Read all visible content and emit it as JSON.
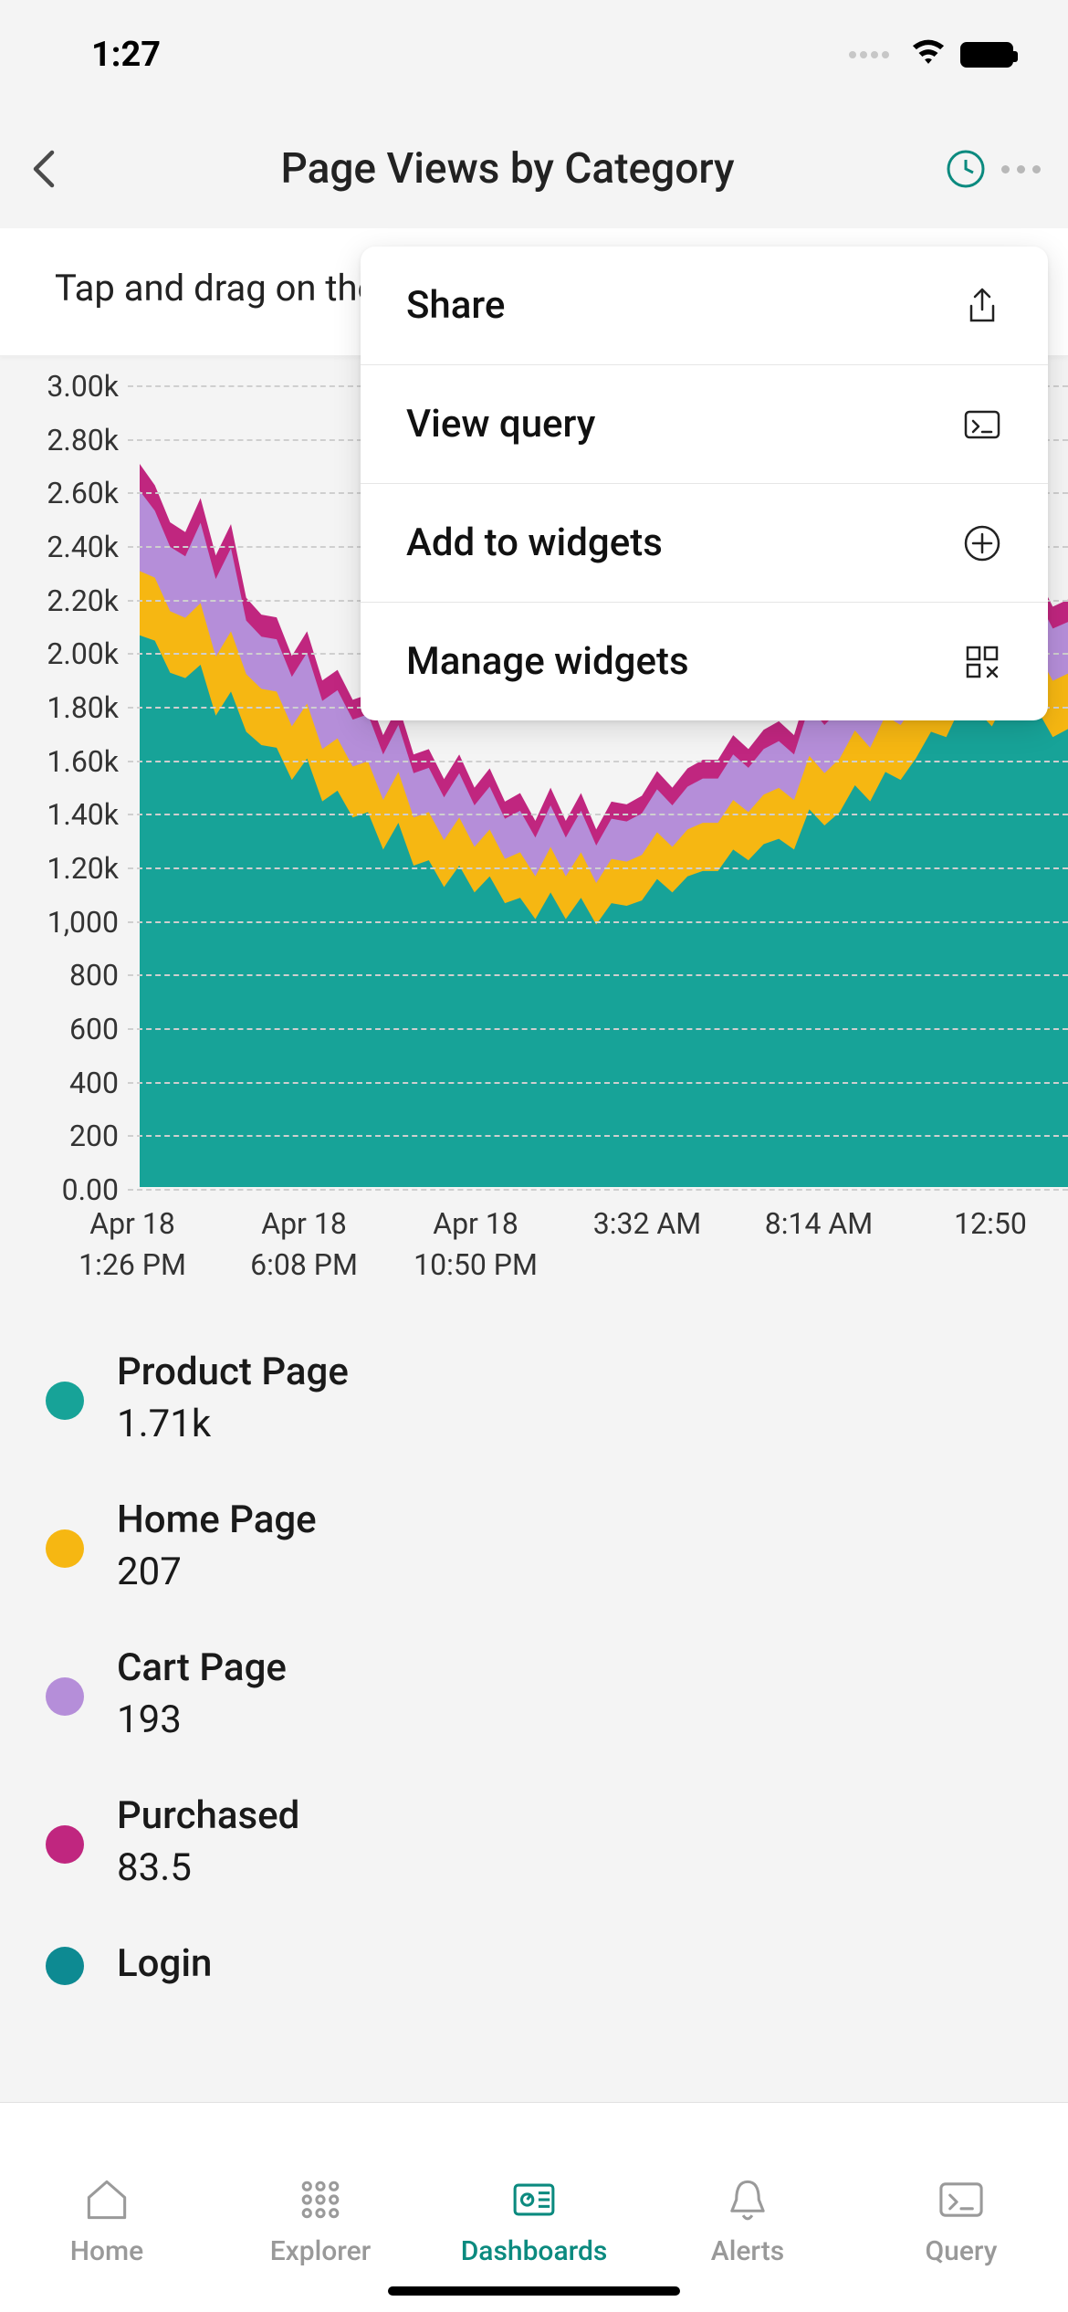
{
  "status": {
    "time": "1:27"
  },
  "header": {
    "title": "Page Views by Category"
  },
  "hint": "Tap and drag on the chart",
  "menu": {
    "items": [
      {
        "label": "Share",
        "icon": "share-icon"
      },
      {
        "label": "View query",
        "icon": "terminal-icon"
      },
      {
        "label": "Add to widgets",
        "icon": "plus-circle-icon"
      },
      {
        "label": "Manage widgets",
        "icon": "widgets-icon"
      }
    ]
  },
  "chart_data": {
    "type": "area",
    "stacking": "stacked",
    "ylabel": "",
    "xlabel": "",
    "ylim": [
      0,
      3000
    ],
    "y_ticks": [
      "3.00k",
      "2.80k",
      "2.60k",
      "2.40k",
      "2.20k",
      "2.00k",
      "1.80k",
      "1.60k",
      "1.40k",
      "1.20k",
      "1,000",
      "800",
      "600",
      "400",
      "200",
      "0.00"
    ],
    "x_ticks": [
      {
        "line1": "Apr 18",
        "line2": "1:26 PM"
      },
      {
        "line1": "Apr 18",
        "line2": "6:08 PM"
      },
      {
        "line1": "Apr 18",
        "line2": "10:50 PM"
      },
      {
        "line1": "3:32 AM",
        "line2": ""
      },
      {
        "line1": "8:14 AM",
        "line2": ""
      },
      {
        "line1": "12:50",
        "line2": ""
      }
    ],
    "series": [
      {
        "name": "Product Page",
        "color": "#17a398",
        "latest": "1.71k",
        "values": [
          2060,
          2040,
          1920,
          1900,
          1950,
          1760,
          1850,
          1700,
          1650,
          1640,
          1520,
          1600,
          1440,
          1480,
          1380,
          1400,
          1260,
          1360,
          1200,
          1220,
          1120,
          1200,
          1100,
          1160,
          1060,
          1080,
          1000,
          1100,
          1000,
          1080,
          980,
          1060,
          1050,
          1070,
          1150,
          1100,
          1160,
          1180,
          1180,
          1260,
          1220,
          1280,
          1300,
          1260,
          1410,
          1350,
          1400,
          1500,
          1440,
          1550,
          1520,
          1600,
          1700,
          1680,
          1800,
          1780,
          1720,
          1830,
          1760,
          1780,
          1680,
          1710
        ]
      },
      {
        "name": "Home Page",
        "color": "#f6b712",
        "latest": "207",
        "values": [
          240,
          235,
          230,
          225,
          230,
          220,
          225,
          215,
          210,
          210,
          200,
          205,
          195,
          195,
          190,
          190,
          185,
          190,
          180,
          180,
          175,
          180,
          170,
          175,
          165,
          170,
          160,
          170,
          160,
          170,
          155,
          165,
          165,
          170,
          175,
          170,
          175,
          180,
          180,
          185,
          180,
          185,
          190,
          185,
          200,
          195,
          200,
          205,
          200,
          210,
          205,
          210,
          215,
          215,
          220,
          220,
          215,
          225,
          215,
          215,
          210,
          207
        ]
      },
      {
        "name": "Cart Page",
        "color": "#b58ed9",
        "latest": "193",
        "values": [
          300,
          250,
          240,
          230,
          300,
          290,
          310,
          200,
          195,
          195,
          185,
          190,
          180,
          180,
          175,
          175,
          170,
          175,
          165,
          165,
          160,
          165,
          155,
          160,
          150,
          155,
          145,
          155,
          145,
          155,
          140,
          150,
          150,
          155,
          160,
          155,
          160,
          165,
          165,
          170,
          165,
          170,
          175,
          170,
          185,
          180,
          185,
          190,
          185,
          195,
          190,
          195,
          200,
          200,
          205,
          205,
          200,
          210,
          200,
          200,
          195,
          193
        ]
      },
      {
        "name": "Purchased",
        "color": "#c0267f",
        "latest": "83.5",
        "values": [
          100,
          95,
          92,
          90,
          92,
          88,
          90,
          85,
          82,
          82,
          78,
          80,
          76,
          76,
          74,
          74,
          72,
          74,
          70,
          70,
          68,
          70,
          66,
          68,
          64,
          66,
          62,
          66,
          62,
          66,
          60,
          64,
          64,
          66,
          68,
          66,
          68,
          70,
          70,
          72,
          70,
          72,
          74,
          72,
          78,
          76,
          78,
          80,
          78,
          82,
          80,
          82,
          84,
          84,
          86,
          86,
          84,
          88,
          84,
          84,
          82,
          83.5
        ]
      },
      {
        "name": "Login",
        "color": "#0d8a92",
        "latest": "",
        "values": []
      }
    ]
  },
  "tabs": [
    {
      "label": "Home",
      "icon": "home-icon",
      "active": false
    },
    {
      "label": "Explorer",
      "icon": "grid-icon",
      "active": false
    },
    {
      "label": "Dashboards",
      "icon": "gauge-icon",
      "active": true
    },
    {
      "label": "Alerts",
      "icon": "bell-icon",
      "active": false
    },
    {
      "label": "Query",
      "icon": "terminal-icon",
      "active": false
    }
  ]
}
